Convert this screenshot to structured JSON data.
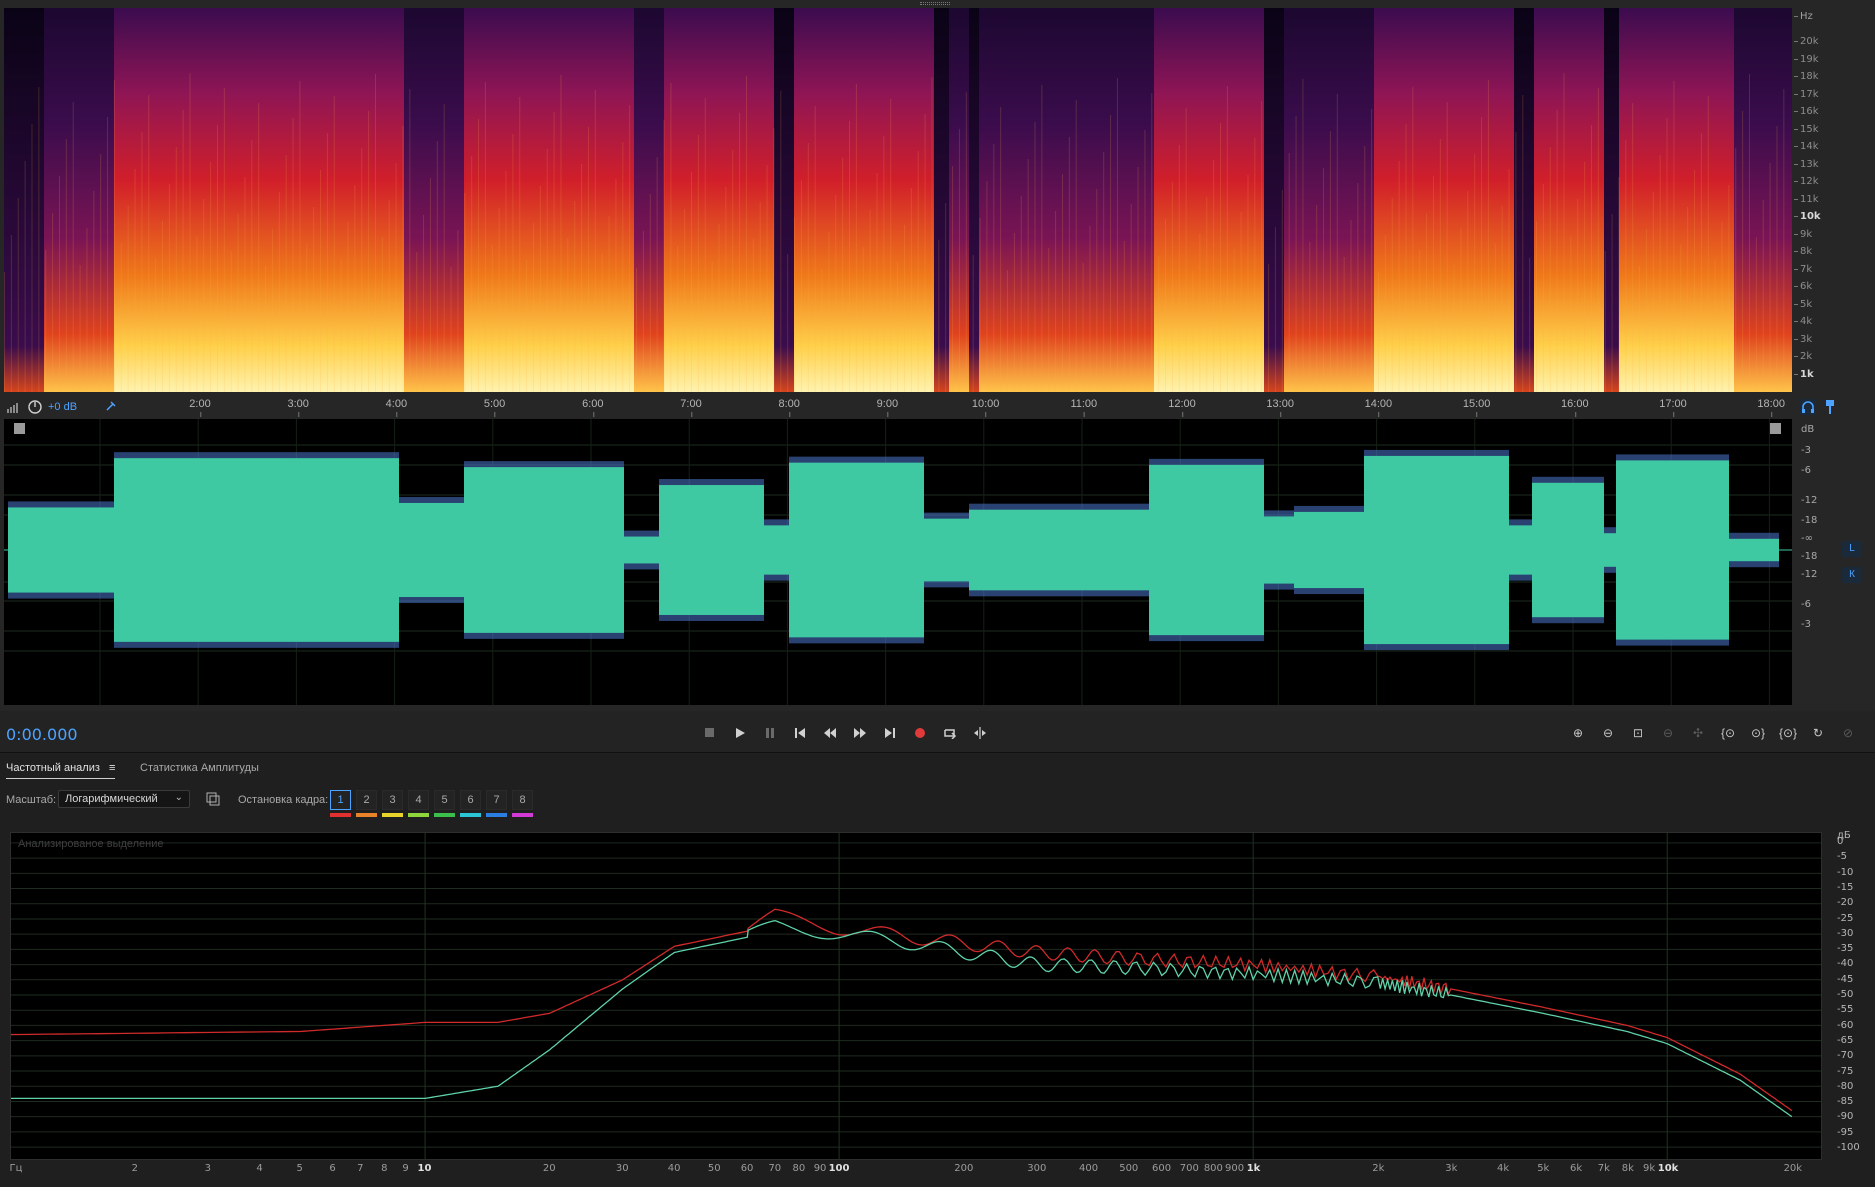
{
  "spectral": {
    "hz_unit": "Hz",
    "hz_labels": [
      "20k",
      "19k",
      "18k",
      "17k",
      "16k",
      "15k",
      "14k",
      "13k",
      "12k",
      "11k",
      "10k",
      "9k",
      "8k",
      "7k",
      "6k",
      "5k",
      "4k",
      "3k",
      "2k",
      "1k"
    ]
  },
  "timeline": {
    "gain": "+0 dB",
    "ticks": [
      "2:00",
      "3:00",
      "4:00",
      "5:00",
      "6:00",
      "7:00",
      "8:00",
      "9:00",
      "10:00",
      "11:00",
      "12:00",
      "13:00",
      "14:00",
      "15:00",
      "16:00",
      "17:00",
      "18:00"
    ]
  },
  "waveform": {
    "db_unit": "dB",
    "db_labels": [
      "-3",
      "-6",
      "-12",
      "-18",
      "-∞",
      "-18",
      "-12",
      "-6",
      "-3"
    ],
    "channel_left": "L",
    "channel_right": "К"
  },
  "transport": {
    "time": "0:00.000",
    "buttons": [
      "stop",
      "play",
      "pause",
      "go-to-start",
      "rewind",
      "fast-forward",
      "go-to-end",
      "record",
      "loop",
      "skip-selection"
    ],
    "record_color": "#e03a3a"
  },
  "panel": {
    "tabs": [
      {
        "label": "Частотный анализ",
        "active": true
      },
      {
        "label": "Статистика Амплитуды",
        "active": false
      }
    ],
    "scale_label": "Масштаб:",
    "scale_value": "Логарифмический",
    "freeze_label": "Остановка кадра:",
    "frames": [
      {
        "label": "1",
        "color": "#e03030"
      },
      {
        "label": "2",
        "color": "#e8832a"
      },
      {
        "label": "3",
        "color": "#e8d42a"
      },
      {
        "label": "4",
        "color": "#8ed63a"
      },
      {
        "label": "5",
        "color": "#3cbf4a"
      },
      {
        "label": "6",
        "color": "#2ac6d6"
      },
      {
        "label": "7",
        "color": "#2a7fe0"
      },
      {
        "label": "8",
        "color": "#d23ad6"
      }
    ],
    "caption": "Анализированое выделение",
    "db_unit": "дБ",
    "db_labels": [
      "0",
      "-5",
      "-10",
      "-15",
      "-20",
      "-25",
      "-30",
      "-35",
      "-40",
      "-45",
      "-50",
      "-55",
      "-60",
      "-65",
      "-70",
      "-75",
      "-80",
      "-85",
      "-90",
      "-95",
      "-100"
    ],
    "freq_unit": "Гц",
    "freq_labels": [
      "2",
      "3",
      "4",
      "5",
      "6",
      "7",
      "8",
      "9",
      "10",
      "20",
      "30",
      "40",
      "50",
      "60",
      "70",
      "80",
      "90",
      "100",
      "200",
      "300",
      "400",
      "500",
      "600",
      "700",
      "800",
      "900",
      "1k",
      "2k",
      "3k",
      "4k",
      "5k",
      "6k",
      "7k",
      "8k",
      "9k",
      "10k",
      "20k"
    ]
  },
  "chart_data": {
    "type": "line",
    "title": "",
    "xlabel": "Гц",
    "ylabel": "дБ",
    "x_scale": "log",
    "xlim": [
      1,
      22000
    ],
    "ylim": [
      -100,
      0
    ],
    "x": [
      1,
      5,
      10,
      15,
      20,
      30,
      40,
      60,
      70,
      100,
      150,
      200,
      300,
      500,
      1000,
      2000,
      3000,
      5000,
      8000,
      10000,
      15000,
      20000
    ],
    "series": [
      {
        "color": "#d02a2a",
        "values": [
          -63,
          -62,
          -59,
          -59,
          -56,
          -45,
          -34,
          -29,
          -24,
          -28,
          -31,
          -33,
          -36,
          -38,
          -40,
          -44,
          -48,
          -54,
          -60,
          -64,
          -76,
          -88
        ]
      },
      {
        "color": "#5fd2a8",
        "values": [
          -84,
          -84,
          -84,
          -80,
          -68,
          -48,
          -36,
          -31,
          -27,
          -30,
          -33,
          -36,
          -40,
          -41,
          -43,
          -46,
          -50,
          -56,
          -62,
          -66,
          -78,
          -90
        ]
      }
    ],
    "grid": true
  },
  "colors": {
    "waveform_fill": "#3fc9a3",
    "waveform_edge": "#4a78d0",
    "accent": "#4da3ff"
  }
}
